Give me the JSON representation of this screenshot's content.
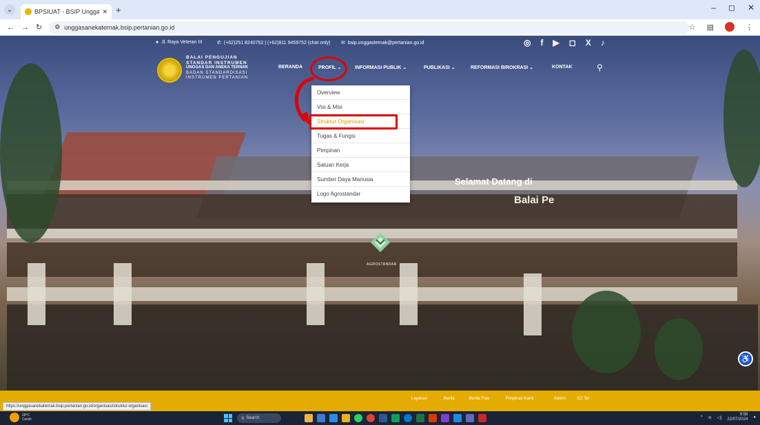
{
  "browser": {
    "tab_title": "BPSIUAT - BSIP Unggas dan Ar...",
    "tab_close": "✕",
    "new_tab": "+",
    "url": "unggasanekaternak.bsip.pertanian.go.id",
    "window_controls": [
      "–",
      "◻",
      "✕"
    ]
  },
  "info_bar": {
    "address": "Jl. Raya Veteran III",
    "phone": "(+62)251 8240752 | (+62)811 9459752 (chat only)",
    "email": "bsip.unggasternak@pertanian.go.id",
    "social_icons": [
      "whatsapp-icon",
      "facebook-icon",
      "youtube-icon",
      "instagram-icon",
      "x-icon",
      "tiktok-icon"
    ]
  },
  "logo": {
    "line1": "BALAI PENGUJIAN",
    "line2": "STANDAR INSTRUMEN",
    "line3": "UNGGAS DAN ANEKA TERNAK",
    "line4": "BADAN STANDARDISASI",
    "line5": "INSTRUMEN PERTANIAN"
  },
  "nav": {
    "items": [
      {
        "label": "BERANDA"
      },
      {
        "label": "PROFIL ⌄"
      },
      {
        "label": "INFORMASI PUBLIK ⌄"
      },
      {
        "label": "PUBLIKASI ⌄"
      },
      {
        "label": "REFORMASI BIROKRASI ⌄"
      },
      {
        "label": "KONTAK"
      }
    ]
  },
  "dropdown": {
    "items": [
      {
        "label": "Overview"
      },
      {
        "label": "Visi & Misi"
      },
      {
        "label": "Struktur Organisasi"
      },
      {
        "label": "Tugas & Fungsi"
      },
      {
        "label": "Pimpinan"
      },
      {
        "label": "Satuan Kerja"
      },
      {
        "label": "Sumber Daya Manusia"
      },
      {
        "label": "Logo Agrostandar"
      }
    ],
    "active_index": 2
  },
  "hero": {
    "line1": "Selamat Datang di",
    "line2": "Balai Pe",
    "center_logo_label": "AGROSTANDAR"
  },
  "footer": {
    "status_url": "https://unggasanekaternak.bsip.pertanian.go.id/organisasi/struktur-organisasi",
    "links": [
      "Layanan",
      "Berita",
      "Berita Foto",
      "Pimpinan Kami",
      "Admin",
      "EZ Tel"
    ]
  },
  "taskbar": {
    "weather_temp": "28°C",
    "weather_desc": "Cerah",
    "search_label": "Search",
    "time": "9:58",
    "date": "22/07/2024"
  },
  "colors": {
    "accent": "#e4ac00",
    "annotation": "#e00000"
  }
}
